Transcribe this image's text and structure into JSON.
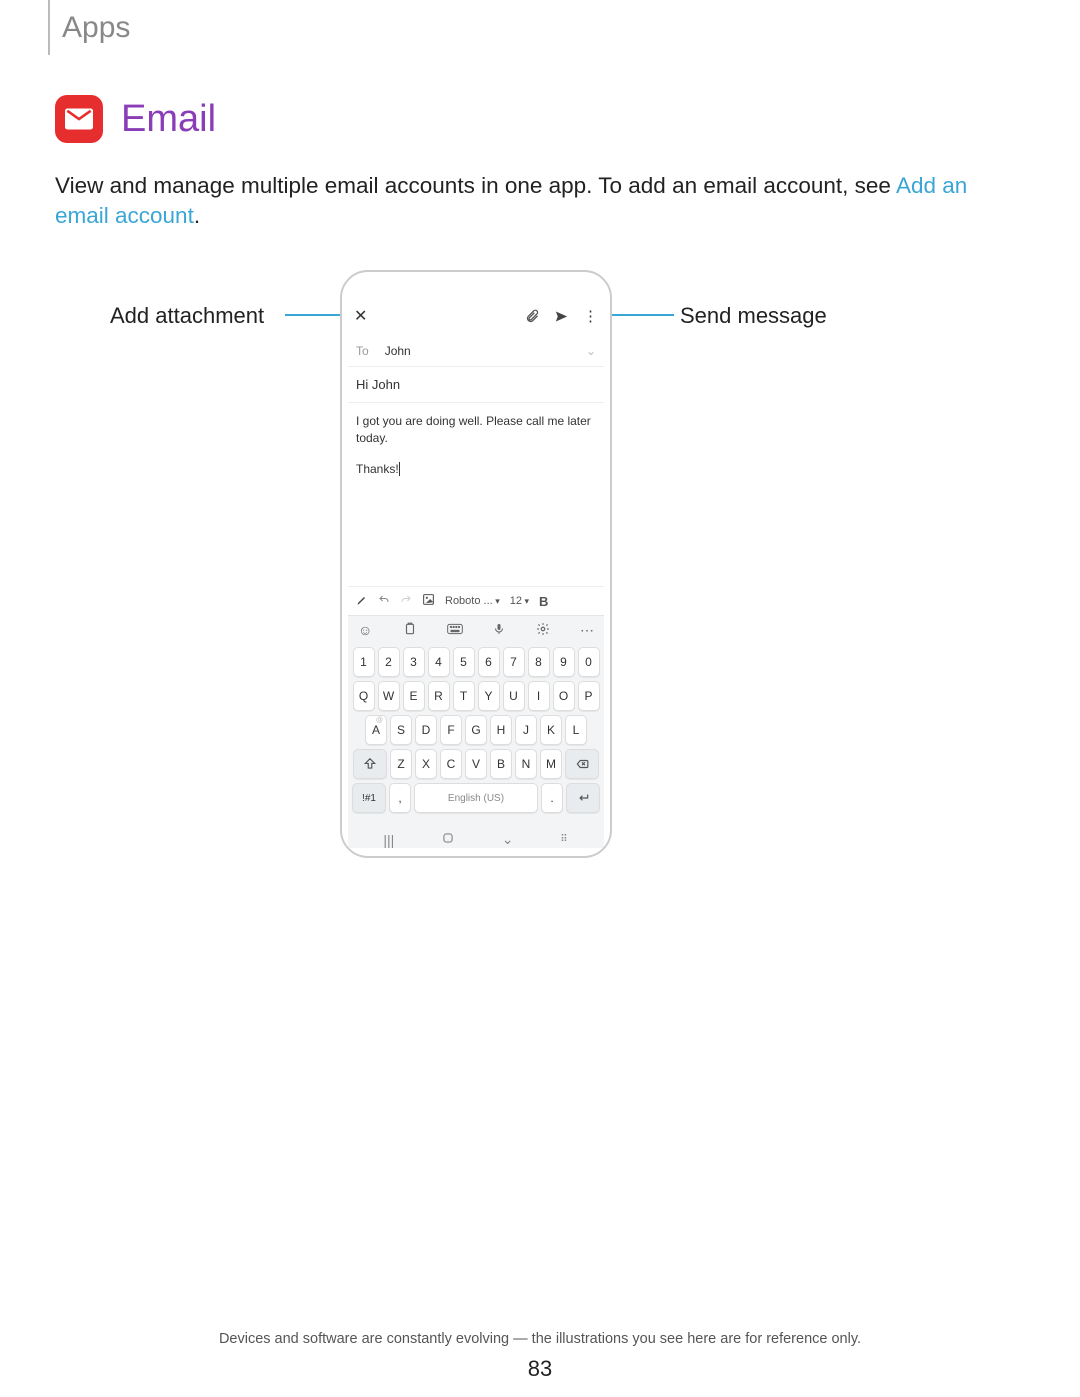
{
  "header": {
    "section": "Apps"
  },
  "title": "Email",
  "description": {
    "prefix": "View and manage multiple email accounts in one app. To add an email account, see ",
    "link": "Add an email account",
    "suffix": "."
  },
  "callouts": {
    "left": "Add attachment",
    "right": "Send message"
  },
  "compose": {
    "to_label": "To",
    "to_name": "John",
    "subject": "Hi John",
    "body_line1": "I got you are doing well. Please call me later today.",
    "body_line2": "Thanks!"
  },
  "format_bar": {
    "font": "Roboto ...",
    "size": "12"
  },
  "keyboard": {
    "row_num": [
      "1",
      "2",
      "3",
      "4",
      "5",
      "6",
      "7",
      "8",
      "9",
      "0"
    ],
    "row1": [
      "Q",
      "W",
      "E",
      "R",
      "T",
      "Y",
      "U",
      "I",
      "O",
      "P"
    ],
    "row2": [
      "A",
      "S",
      "D",
      "F",
      "G",
      "H",
      "J",
      "K",
      "L"
    ],
    "row3": [
      "Z",
      "X",
      "C",
      "V",
      "B",
      "N",
      "M"
    ],
    "sym": "!#1",
    "comma": ",",
    "space": "English (US)",
    "period": "."
  },
  "footer": {
    "note": "Devices and software are constantly evolving — the illustrations you see here are for reference only.",
    "page": "83"
  }
}
